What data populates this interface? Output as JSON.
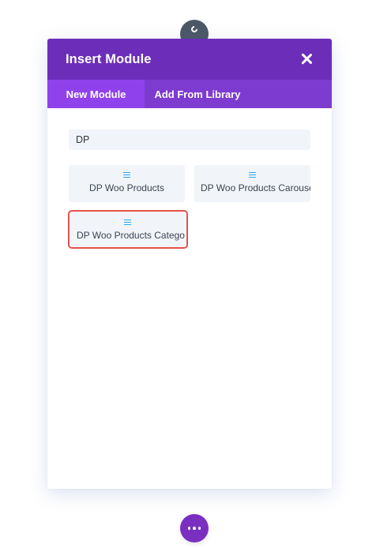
{
  "modal": {
    "title": "Insert Module",
    "close_icon": "close-icon"
  },
  "tabs": [
    {
      "label": "New Module",
      "active": true
    },
    {
      "label": "Add From Library",
      "active": false
    }
  ],
  "search": {
    "value": "DP"
  },
  "modules": [
    {
      "label": "DP Woo Products",
      "icon": "module-icon"
    },
    {
      "label": "DP Woo Products Carousel",
      "icon": "module-icon"
    },
    {
      "label": "DP Woo Products Category",
      "icon": "module-icon",
      "highlighted": true
    }
  ],
  "colors": {
    "header": "#6c2eb9",
    "tab_bar": "#7e3bd0",
    "active_tab": "#8f42ec",
    "icon_blue": "#2ea3f2",
    "highlight": "#e5504c",
    "bottom_button": "#7a2fc0"
  },
  "top_handle_icon": "drag-handle-icon",
  "bottom_button_icon": "more-dots-icon"
}
